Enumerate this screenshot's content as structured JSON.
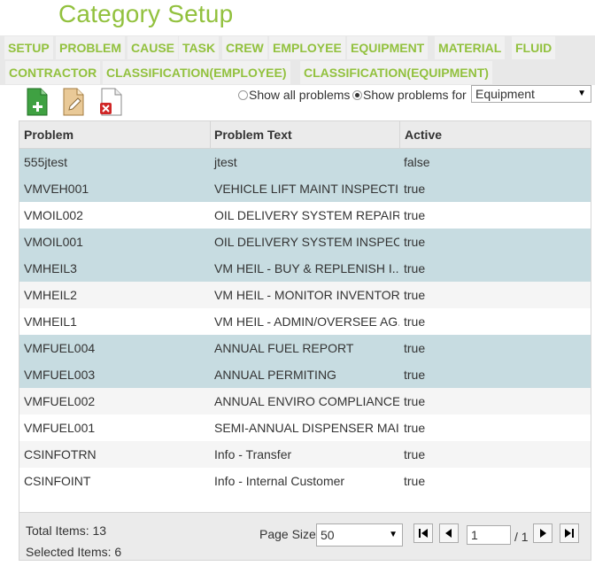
{
  "page_title": "Category Setup",
  "tabs_row1": [
    "SETUP",
    "PROBLEM",
    "CAUSE",
    "TASK",
    "CREW",
    "EMPLOYEE",
    "EQUIPMENT",
    "MATERIAL",
    "FLUID"
  ],
  "tabs_row2": [
    "CONTRACTOR",
    "CLASSIFICATION(EMPLOYEE)",
    "CLASSIFICATION(EQUIPMENT)"
  ],
  "toolbar": {
    "icons": [
      "add-document-icon",
      "edit-document-icon",
      "delete-document-icon"
    ]
  },
  "filter": {
    "show_all_label": "Show all problems",
    "show_for_label": "Show problems for",
    "selected": "show_for",
    "equipment_value": "Equipment"
  },
  "grid": {
    "columns": [
      "Problem",
      "Problem Text",
      "Active"
    ],
    "rows": [
      {
        "problem": "555jtest",
        "text": "jtest",
        "active": "false",
        "selected": true
      },
      {
        "problem": "VMVEH001",
        "text": "VEHICLE LIFT MAINT INSPECTI...",
        "active": "true",
        "selected": true
      },
      {
        "problem": "VMOIL002",
        "text": "OIL DELIVERY SYSTEM REPAIR",
        "active": "true",
        "selected": false
      },
      {
        "problem": "VMOIL001",
        "text": "OIL DELIVERY SYSTEM INSPEC...",
        "active": "true",
        "selected": true
      },
      {
        "problem": "VMHEIL3",
        "text": "VM HEIL - BUY & REPLENISH I...",
        "active": "true",
        "selected": true
      },
      {
        "problem": "VMHEIL2",
        "text": "VM HEIL - MONITOR INVENTORY",
        "active": "true",
        "selected": false
      },
      {
        "problem": "VMHEIL1",
        "text": "VM HEIL - ADMIN/OVERSEE AG...",
        "active": "true",
        "selected": false
      },
      {
        "problem": "VMFUEL004",
        "text": "ANNUAL FUEL REPORT",
        "active": "true",
        "selected": true
      },
      {
        "problem": "VMFUEL003",
        "text": "ANNUAL PERMITING",
        "active": "true",
        "selected": true
      },
      {
        "problem": "VMFUEL002",
        "text": "ANNUAL ENVIRO COMPLIANCE ...",
        "active": "true",
        "selected": false
      },
      {
        "problem": "VMFUEL001",
        "text": "SEMI-ANNUAL DISPENSER MAI...",
        "active": "true",
        "selected": false
      },
      {
        "problem": "CSINFOTRN",
        "text": "Info - Transfer",
        "active": "true",
        "selected": false
      },
      {
        "problem": "CSINFOINT",
        "text": "Info - Internal Customer",
        "active": "true",
        "selected": false
      }
    ]
  },
  "footer": {
    "total_items": "Total Items: 13",
    "selected_items": "Selected Items: 6",
    "page_size_label": "Page Size:",
    "page_size_value": "50",
    "current_page": "1",
    "page_total": "/ 1"
  },
  "colors": {
    "accent": "#92c13e",
    "selected_row": "#c7dce1",
    "alt_row": "#f5f5f5"
  }
}
